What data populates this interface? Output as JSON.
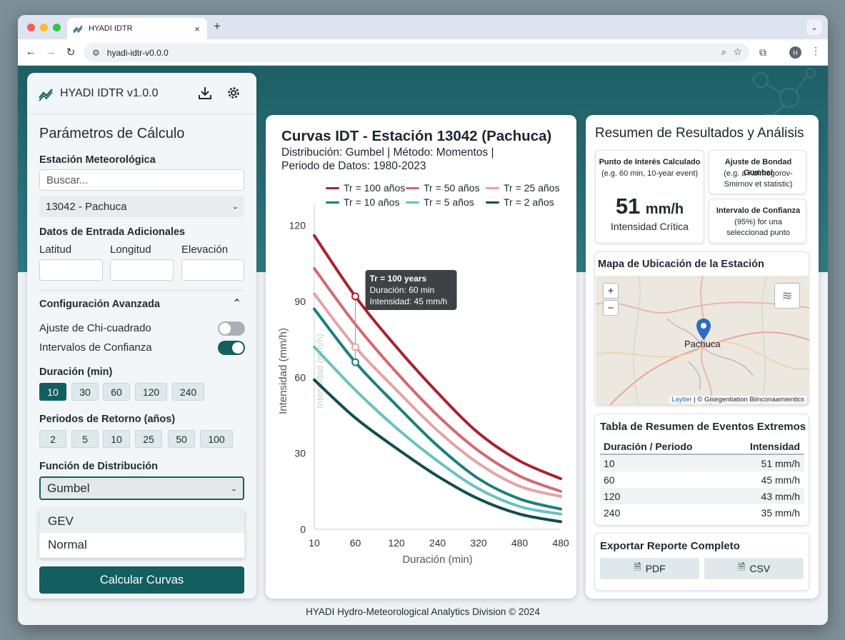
{
  "browser": {
    "tab_title": "HYADI IDTR",
    "tab_close": "×",
    "new_tab": "+",
    "url": "hyadi-idtr-v0.0.0",
    "profile_initial": "H"
  },
  "header": {
    "app_title": "HYADI IDTR v1.0.0"
  },
  "params": {
    "title": "Parámetros de Cálculo",
    "station_label": "Estación Meteorológica",
    "search_placeholder": "Buscar...",
    "station_value": "13042 - Pachuca",
    "extra_label": "Datos de Entrada Adicionales",
    "lat_label": "Latitud",
    "lon_label": "Longitud",
    "elev_label": "Elevación",
    "lat_value": "",
    "lon_value": "",
    "elev_value": "",
    "advanced_label": "Configuración Avanzada",
    "chi_label": "Ajuste de Chi-cuadrado",
    "chi_on": false,
    "ci_label": "Intervalos de Confianza",
    "ci_on": true,
    "duration_label": "Duración (min)",
    "durations": [
      "10",
      "30",
      "60",
      "120",
      "240"
    ],
    "duration_selected": "10",
    "return_label": "Periodos de Retorno (años)",
    "returns": [
      "2",
      "5",
      "10",
      "25",
      "50",
      "100"
    ],
    "dist_label": "Función de Distribución",
    "dist_value": "Gumbel",
    "dist_options": [
      "GEV",
      "Normal"
    ],
    "calc_button": "Calcular Curvas"
  },
  "chart_card": {
    "title": "Curvas IDT - Estación 13042 (Pachuca)",
    "subtitle_line1": "Distribución: Gumbel | Método: Momentos |",
    "subtitle_line2": "Periodo de Datos: 1980-2023",
    "tooltip": {
      "title": "Tr = 100 years",
      "line1": "Duración: 60 min",
      "line2": "Intensidad: 45 mm/h"
    },
    "ghost_ylabel": "Intensidad (mm/h)"
  },
  "chart_data": {
    "type": "line",
    "title": "Curvas IDT - Estación 13042 (Pachuca)",
    "xlabel": "Duración (min)",
    "ylabel": "Intensidad (mm/h)",
    "x_ticks": [
      "10",
      "60",
      "120",
      "240",
      "320",
      "480",
      "480"
    ],
    "y_ticks": [
      0,
      30,
      60,
      90,
      120
    ],
    "ylim": [
      0,
      125
    ],
    "x_positions": [
      0,
      1,
      2,
      3,
      4,
      5,
      6
    ],
    "series": [
      {
        "name": "Tr = 100 años",
        "color": "#a8232b",
        "values": [
          116,
          92,
          72,
          54,
          38,
          27,
          20
        ]
      },
      {
        "name": "Tr = 50 años",
        "color": "#d36a70",
        "values": [
          103,
          81,
          62,
          45,
          31,
          21,
          15
        ]
      },
      {
        "name": "Tr = 25 años",
        "color": "#e6a3a3",
        "values": [
          93,
          72,
          55,
          39,
          26,
          17,
          13
        ]
      },
      {
        "name": "Tr = 10 años",
        "color": "#1b7f80",
        "values": [
          87,
          66,
          49,
          33,
          20,
          12,
          8
        ]
      },
      {
        "name": "Tr = 5 años",
        "color": "#69c2c0",
        "values": [
          72,
          55,
          40,
          27,
          16,
          9,
          6
        ]
      },
      {
        "name": "Tr = 2 años",
        "color": "#134d4f",
        "values": [
          59,
          44,
          32,
          21,
          12,
          6,
          3
        ]
      }
    ],
    "grid": false,
    "legend": "top"
  },
  "results": {
    "title": "Resumen de Resultados y Análisis",
    "poi_title": "Punto de Interés Calculado",
    "poi_sub": "(e.g. 60 min, 10-year event)",
    "poi_value": "51",
    "poi_unit": "mm/h",
    "poi_caption": "Intensidad Crítica",
    "gumbel_title": "Ajuste de Bondad Gumbel",
    "gumbel_sub": "(e.g. a Kolmogorov-Smirnov et statistic)",
    "ci_title": "Intervalo de Confianza",
    "ci_sub": "(95%) for una seleccionad punto",
    "map_title": "Mapa de Ubicación de la Estación",
    "map_place": "Pachuca",
    "map_zoom_in": "+",
    "map_zoom_out": "−",
    "map_attr_link": "Laytier",
    "map_attr_text": "| © Gisegentiation Biinconaamientics",
    "table_title": "Tabla de Resumen de Eventos Extremos",
    "table_headers": [
      "Duración / Periodo",
      "Intensidad"
    ],
    "table_rows": [
      [
        "10",
        "51 mm/h"
      ],
      [
        "60",
        "45 mm/h"
      ],
      [
        "120",
        "43 mm/h"
      ],
      [
        "240",
        "35 mm/h"
      ]
    ],
    "export_title": "Exportar Reporte Completo",
    "export_pdf": "PDF",
    "export_csv": "CSV"
  },
  "footer": "HYADI Hydro-Meteorological Analytics Division © 2024",
  "colors": {
    "brand": "#135f5f",
    "banner": "#1f5f66"
  }
}
